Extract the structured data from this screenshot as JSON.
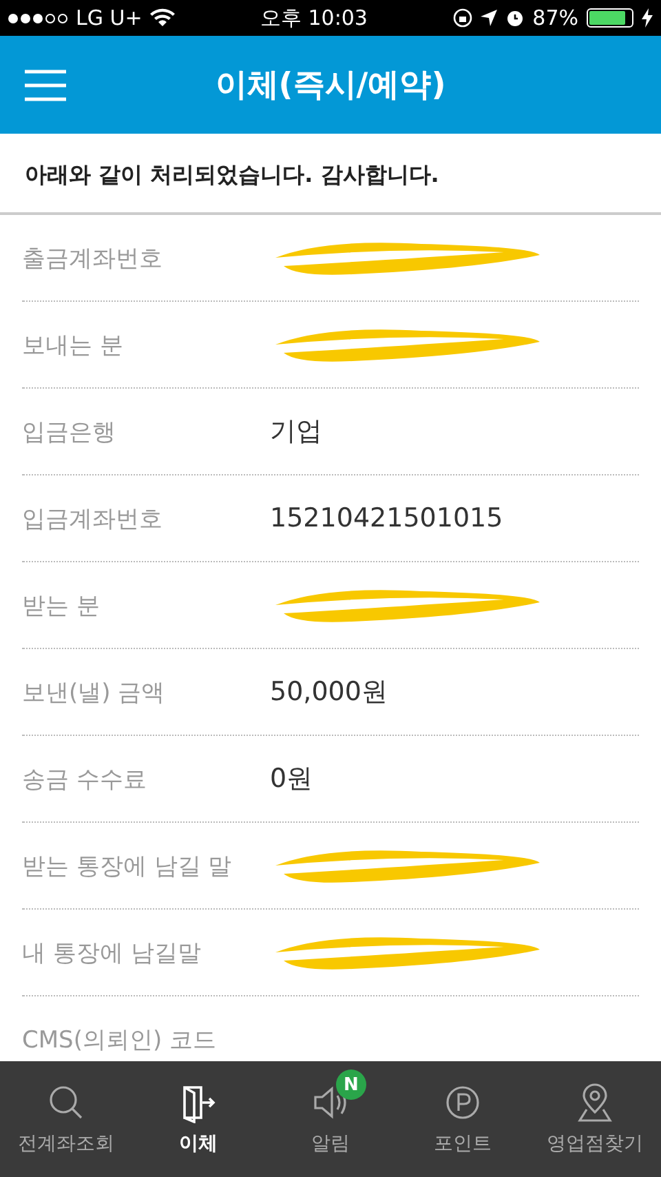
{
  "status_bar": {
    "carrier": "LG U+",
    "time": "오후 10:03",
    "battery": "87%"
  },
  "header": {
    "title": "이체(즉시/예약)"
  },
  "notice": "아래와 같이 처리되었습니다. 감사합니다.",
  "rows": [
    {
      "label": "출금계좌번호",
      "redacted": true
    },
    {
      "label": "보내는 분",
      "redacted": true
    },
    {
      "label": "입금은행",
      "value": "기업",
      "redacted": false
    },
    {
      "label": "입금계좌번호",
      "value": "15210421501015",
      "redacted": false
    },
    {
      "label": "받는 분",
      "redacted": true
    },
    {
      "label": "보낸(낼) 금액",
      "value": "50,000원",
      "redacted": false
    },
    {
      "label": "송금 수수료",
      "value": "0원",
      "redacted": false
    },
    {
      "label": "받는 통장에 남길 말",
      "redacted": true
    },
    {
      "label": "내 통장에 남길말",
      "redacted": true
    },
    {
      "label": "CMS(의뢰인) 코드",
      "redacted": false
    }
  ],
  "tab_bar": [
    {
      "kind": "search",
      "label": "전계좌조회",
      "selected": false
    },
    {
      "kind": "transfer",
      "label": "이체",
      "selected": true
    },
    {
      "kind": "alert",
      "label": "알림",
      "selected": false,
      "badge": "N"
    },
    {
      "kind": "point",
      "label": "포인트",
      "selected": false
    },
    {
      "kind": "branch",
      "label": "영업점찾기",
      "selected": false
    }
  ]
}
